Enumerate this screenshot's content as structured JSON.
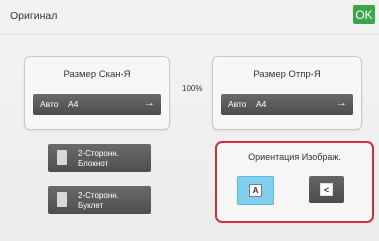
{
  "header": {
    "title": "Оригинал",
    "ok_label": "OK"
  },
  "scan_size": {
    "title": "Размер Скан-Я",
    "mode": "Авто",
    "size": "A4"
  },
  "send_size": {
    "title": "Размер Отпр-Я",
    "mode": "Авто",
    "size": "A4"
  },
  "ratio": "100%",
  "options": [
    {
      "line1": "2-Сторонн.",
      "line2": "Блокнот"
    },
    {
      "line1": "2-Сторонн.",
      "line2": "Буклет"
    }
  ],
  "orientation": {
    "title": "Ориентация Изображ.",
    "portrait_glyph": "A",
    "landscape_glyph": "<"
  },
  "colors": {
    "ok_green": "#3aa64a",
    "highlight_red": "#d52d3a",
    "selected_blue": "#7fd0ee"
  },
  "icons": {
    "arrow": "→"
  }
}
